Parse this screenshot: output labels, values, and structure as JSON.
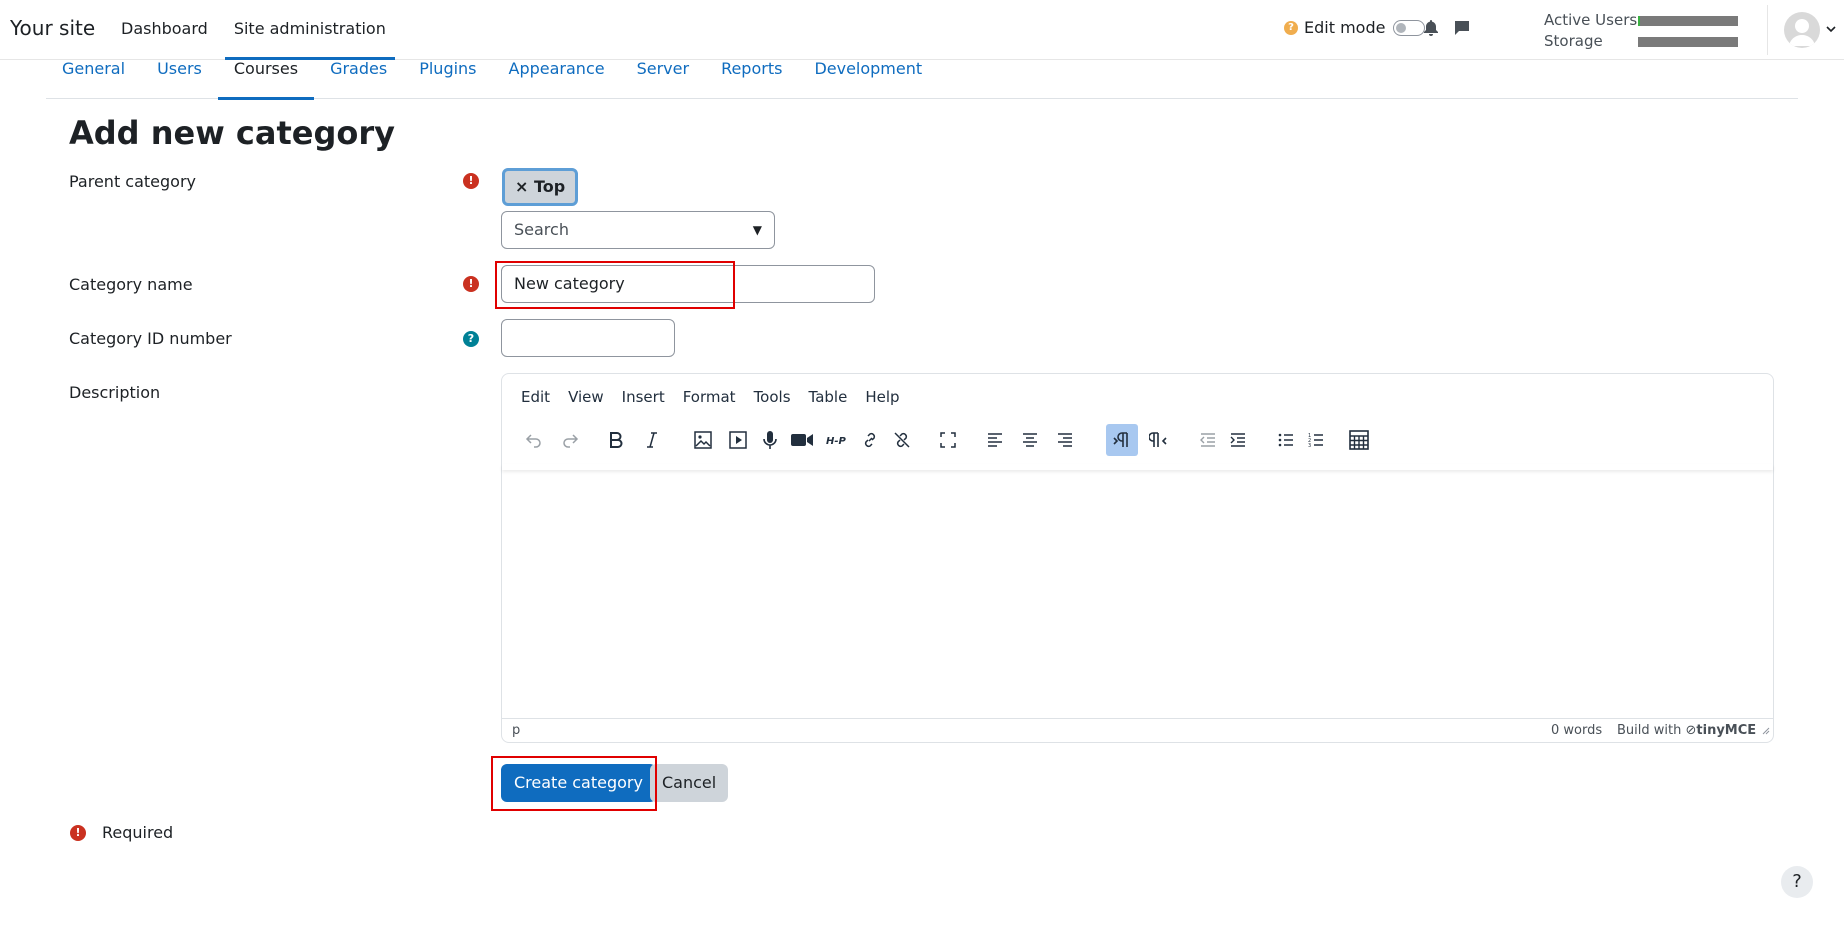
{
  "navbar": {
    "site_name": "Your site",
    "links": [
      {
        "label": "Dashboard",
        "active": false
      },
      {
        "label": "Site administration",
        "active": true
      }
    ],
    "edit_mode_label": "Edit mode",
    "edit_mode_on": false,
    "usage": [
      {
        "label": "Active Users",
        "fraction": 0.02
      },
      {
        "label": "Storage",
        "fraction": 0.0
      }
    ]
  },
  "secondary_nav": {
    "tabs": [
      "General",
      "Users",
      "Courses",
      "Grades",
      "Plugins",
      "Appearance",
      "Server",
      "Reports",
      "Development"
    ],
    "active": "Courses"
  },
  "page": {
    "title": "Add new category",
    "parent_category": {
      "label": "Parent category",
      "selected_chip": "× Top",
      "search_placeholder": "Search"
    },
    "category_name": {
      "label": "Category name",
      "value": "New category"
    },
    "category_id": {
      "label": "Category ID number",
      "value": ""
    },
    "description": {
      "label": "Description",
      "menus": [
        "Edit",
        "View",
        "Insert",
        "Format",
        "Tools",
        "Table",
        "Help"
      ],
      "toolbar_icons": [
        "undo-icon",
        "redo-icon",
        "bold-icon",
        "italic-icon",
        "image-icon",
        "media-icon",
        "record-audio-icon",
        "record-video-icon",
        "h5p-icon",
        "link-icon",
        "unlink-icon",
        "fullscreen-icon",
        "align-left-icon",
        "align-center-icon",
        "align-right-icon",
        "ltr-icon",
        "rtl-icon",
        "outdent-icon",
        "indent-icon",
        "bullet-list-icon",
        "numbered-list-icon",
        "equation-icon"
      ],
      "status_path": "p",
      "word_count": "0 words",
      "brand_prefix": "Build with",
      "brand_name": "tinyMCE"
    },
    "submit_label": "Create category",
    "cancel_label": "Cancel",
    "required_note": "Required"
  },
  "colors": {
    "primary": "#0f6cbf",
    "required": "#ca3120",
    "info": "#008196",
    "highlight": "#e00000"
  }
}
